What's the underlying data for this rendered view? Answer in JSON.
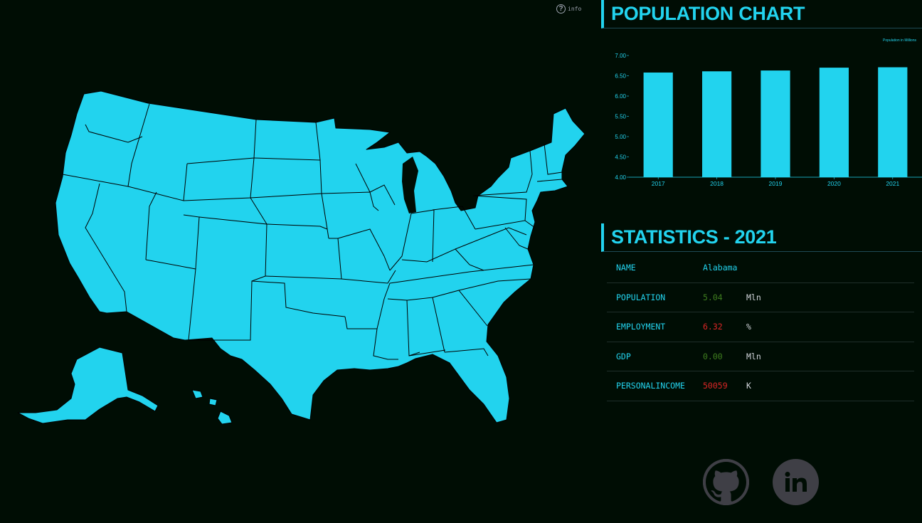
{
  "info": {
    "label": "info"
  },
  "population_section": {
    "title": "POPULATION CHART",
    "legend": "Population in Millions"
  },
  "chart_data": {
    "type": "bar",
    "title": "POPULATION CHART",
    "legend": "Population in Millions",
    "categories": [
      "2017",
      "2018",
      "2019",
      "2020",
      "2021"
    ],
    "values": [
      6.58,
      6.61,
      6.63,
      6.7,
      6.71
    ],
    "ylim": [
      4.0,
      7.0
    ],
    "yticks": [
      "4.00",
      "4.50",
      "5.00",
      "5.50",
      "6.00",
      "6.50",
      "7.00"
    ],
    "grid": false,
    "bar_color": "#22d3ee"
  },
  "statistics_section": {
    "title": "STATISTICS - 2021",
    "rows": [
      {
        "key": "NAME",
        "value": "Alabama",
        "unit": "",
        "color": "#22d3ee"
      },
      {
        "key": "POPULATION",
        "value": "5.04",
        "unit": "Mln",
        "color": "#3f7f1f"
      },
      {
        "key": "EMPLOYMENT",
        "value": "6.32",
        "unit": "%",
        "color": "#dc2626"
      },
      {
        "key": "GDP",
        "value": "0.00",
        "unit": "Mln",
        "color": "#3f7f1f"
      },
      {
        "key": "PERSONALINCOME",
        "value": "50059",
        "unit": "K",
        "color": "#dc2626"
      }
    ]
  },
  "social": {
    "github_icon": "github-icon",
    "linkedin_icon": "linkedin-icon"
  },
  "colors": {
    "accent": "#22d3ee",
    "background": "#000d04",
    "map_border": "#000000"
  }
}
